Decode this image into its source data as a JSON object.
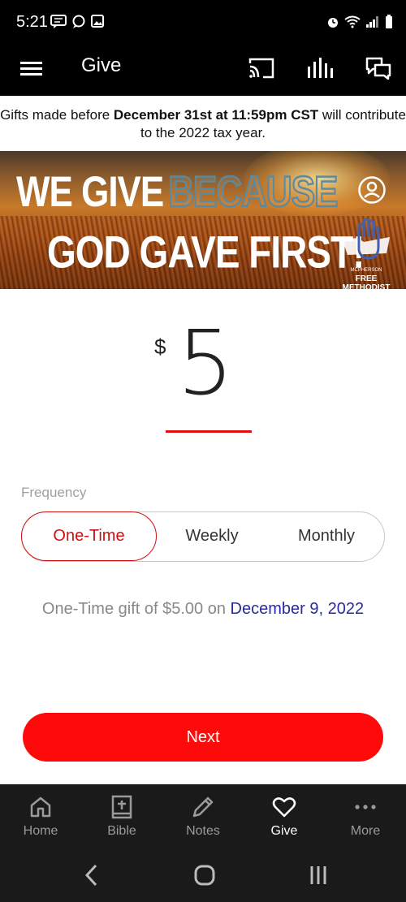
{
  "status_bar": {
    "time": "5:21",
    "left_icons": [
      "message-icon",
      "chat-bubble-icon",
      "image-icon"
    ],
    "right_icons": [
      "alarm-icon",
      "wifi-icon",
      "signal-icon",
      "battery-icon"
    ]
  },
  "app_bar": {
    "title": "Give",
    "actions": [
      "cast-icon",
      "equalizer-icon",
      "chat-icon"
    ]
  },
  "notice": {
    "part1": "Gifts made before ",
    "bold": "December 31st at 11:59pm CST",
    "part2": " will contribute to the 2022 tax year."
  },
  "banner": {
    "line1_a": "WE GIVE",
    "line1_b": "BECAUSE",
    "line2": "GOD GAVE FIRST!",
    "church_small": "MCPHERSON",
    "church_name": "FREE METHODIST"
  },
  "amount": {
    "currency": "$",
    "value": "5"
  },
  "frequency": {
    "label": "Frequency",
    "options": [
      "One-Time",
      "Weekly",
      "Monthly"
    ],
    "selected": "One-Time"
  },
  "summary": {
    "prefix": "One-Time gift of $5.00 on ",
    "date": "December 9, 2022"
  },
  "next_button": "Next",
  "bottom_nav": {
    "items": [
      {
        "label": "Home",
        "icon": "home-icon"
      },
      {
        "label": "Bible",
        "icon": "bible-icon"
      },
      {
        "label": "Notes",
        "icon": "pencil-icon"
      },
      {
        "label": "Give",
        "icon": "heart-icon"
      },
      {
        "label": "More",
        "icon": "more-dots-icon"
      }
    ],
    "active": "Give"
  },
  "colors": {
    "accent": "#ff0a0a",
    "selected_text": "#d01010",
    "date_link": "#2a2aa0",
    "nav_bg": "#1a1a1a"
  }
}
